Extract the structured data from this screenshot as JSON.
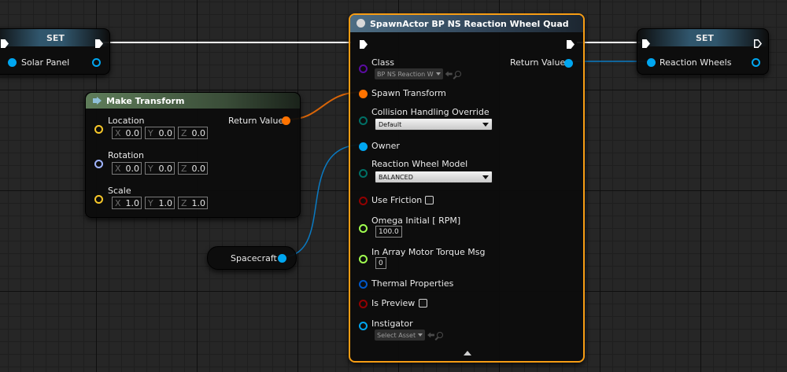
{
  "set_left": {
    "title": "SET",
    "var_label": "Solar Panel"
  },
  "set_right": {
    "title": "SET",
    "var_label": "Reaction Wheels"
  },
  "make_transform": {
    "title": "Make Transform",
    "return_label": "Return Value",
    "location": {
      "label": "Location",
      "x": "0.0",
      "y": "0.0",
      "z": "0.0"
    },
    "rotation": {
      "label": "Rotation",
      "x": "0.0",
      "y": "0.0",
      "z": "0.0"
    },
    "scale": {
      "label": "Scale",
      "x": "1.0",
      "y": "1.0",
      "z": "1.0"
    },
    "axis": {
      "x": "X",
      "y": "Y",
      "z": "Z"
    }
  },
  "spacecraft_var": {
    "label": "Spacecraft"
  },
  "spawn": {
    "title": "SpawnActor BP NS Reaction Wheel Quad",
    "class_label": "Class",
    "class_value": "BP NS Reaction W",
    "return_label": "Return Value",
    "spawn_transform": "Spawn Transform",
    "collision_label": "Collision Handling Override",
    "collision_value": "Default",
    "owner": "Owner",
    "model_label": "Reaction Wheel Model",
    "model_value": "BALANCED",
    "use_friction": "Use Friction",
    "omega_label": "Omega Initial [ RPM]",
    "omega_value": "100.0",
    "torque_label": "In Array Motor Torque Msg",
    "torque_value": "0",
    "thermal": "Thermal Properties",
    "is_preview": "Is Preview",
    "instigator": "Instigator",
    "instigator_value": "Select Asset"
  },
  "colors": {
    "exec": "#ffffff",
    "object": "#00a6f0",
    "transform": "#ff7300",
    "vector": "#f7c729",
    "rotator": "#a0b4ff",
    "byte": "#006f65",
    "struct": "#0058c8",
    "boolean": "#920101",
    "float": "#a0fe50",
    "class": "#5a0ca0",
    "selection": "#f79d14",
    "wire_object": "#0a7ac2",
    "wire_transform": "#d96508"
  }
}
